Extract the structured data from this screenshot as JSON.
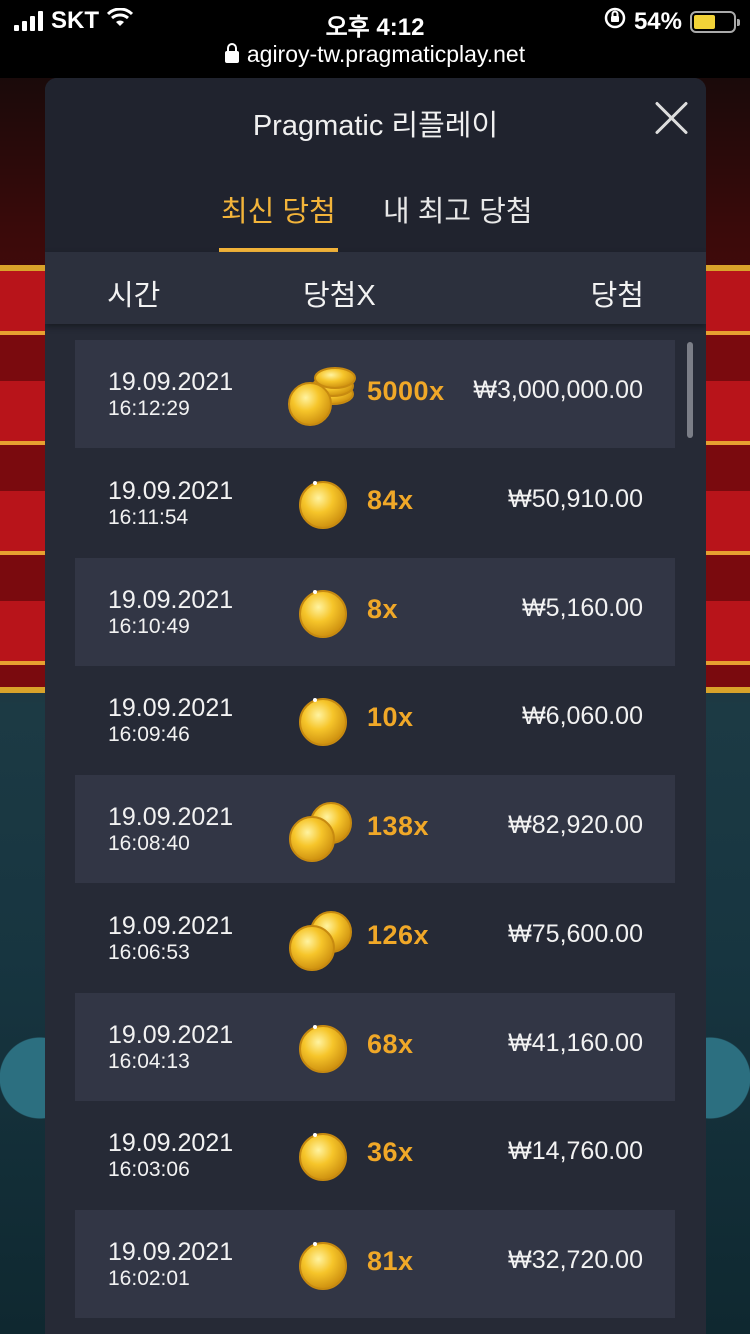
{
  "status_bar": {
    "carrier": "SKT",
    "time": "오후 4:12",
    "battery_percent": "54%",
    "battery_level": 0.54
  },
  "url_bar": {
    "url": "agiroy-tw.pragmaticplay.net"
  },
  "modal": {
    "title": "Pragmatic 리플레이",
    "tabs": [
      {
        "label": "최신 당첨",
        "active": true
      },
      {
        "label": "내 최고 당첨",
        "active": false
      }
    ],
    "columns": {
      "time": "시간",
      "multiplier": "당첨X",
      "win": "당첨"
    },
    "rows": [
      {
        "date": "19.09.2021",
        "time": "16:12:29",
        "multiplier": "5000x",
        "win": "₩3,000,000.00",
        "coin": "coin-stack-icon"
      },
      {
        "date": "19.09.2021",
        "time": "16:11:54",
        "multiplier": "84x",
        "win": "₩50,910.00",
        "coin": "coin-icon"
      },
      {
        "date": "19.09.2021",
        "time": "16:10:49",
        "multiplier": "8x",
        "win": "₩5,160.00",
        "coin": "coin-icon"
      },
      {
        "date": "19.09.2021",
        "time": "16:09:46",
        "multiplier": "10x",
        "win": "₩6,060.00",
        "coin": "coin-icon"
      },
      {
        "date": "19.09.2021",
        "time": "16:08:40",
        "multiplier": "138x",
        "win": "₩82,920.00",
        "coin": "coins-icon"
      },
      {
        "date": "19.09.2021",
        "time": "16:06:53",
        "multiplier": "126x",
        "win": "₩75,600.00",
        "coin": "coins-icon"
      },
      {
        "date": "19.09.2021",
        "time": "16:04:13",
        "multiplier": "68x",
        "win": "₩41,160.00",
        "coin": "coin-icon"
      },
      {
        "date": "19.09.2021",
        "time": "16:03:06",
        "multiplier": "36x",
        "win": "₩14,760.00",
        "coin": "coin-icon"
      },
      {
        "date": "19.09.2021",
        "time": "16:02:01",
        "multiplier": "81x",
        "win": "₩32,720.00",
        "coin": "coin-icon"
      }
    ]
  },
  "colors": {
    "accent": "#f3b43a",
    "multiplier": "#f0a828",
    "modal_bg": "#262a36",
    "row_bg": "#323645"
  }
}
